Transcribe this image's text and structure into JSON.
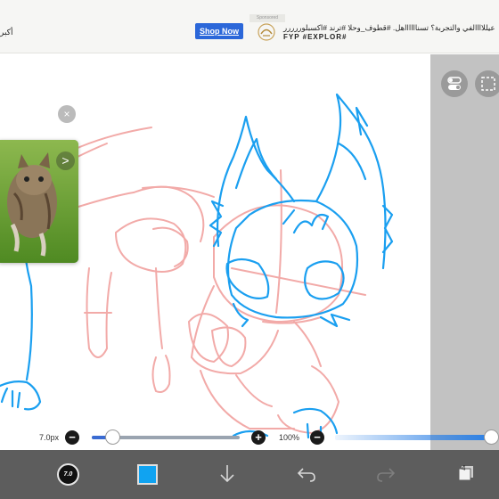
{
  "ad": {
    "left_text": "أكبر",
    "button_label": "Shop Now",
    "tag": "Sponsored",
    "headline": "عيللاااالفي والتجربة؟ تسنااااااهل. #قطوف_وحلا #ترند #اكسبلوررررر",
    "subline": "FYP #EXPLOR#",
    "button_color": "#2b67d9"
  },
  "canvas": {
    "sketch_color": "#f2aaa8",
    "ink_color": "#1a9ff0",
    "background": "#ffffff"
  },
  "thumbnail": {
    "close_icon": "×",
    "next_icon": ">"
  },
  "brush": {
    "size_label": "7.0px",
    "opacity_label": "100%",
    "size_fraction": 0.11,
    "opacity_fraction": 1.0,
    "preview_size_text": "7.0",
    "minus_glyph": "−",
    "plus_glyph": "+"
  },
  "toolbar": {
    "color": "#10a3f1",
    "layers_count": "4"
  },
  "panel": {
    "background": "#c2c2c2"
  }
}
